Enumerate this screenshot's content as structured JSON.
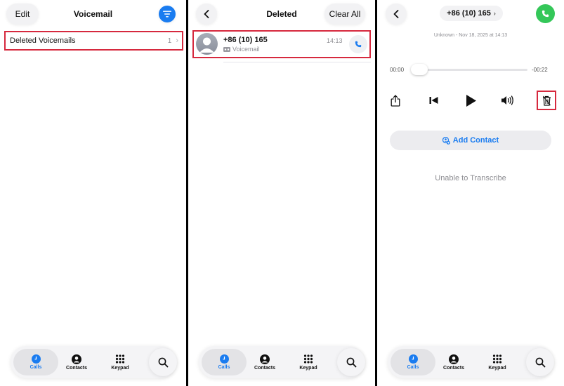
{
  "screen1": {
    "edit_label": "Edit",
    "title": "Voicemail",
    "row_label": "Deleted Voicemails",
    "row_count": "1"
  },
  "screen2": {
    "title": "Deleted",
    "clear_all_label": "Clear All",
    "entry": {
      "number": "+86 (10) 165",
      "subtitle": "Voicemail",
      "time": "14:13"
    }
  },
  "screen3": {
    "number": "+86 (10) 165",
    "meta": "Unknown - Nov 18, 2025 at 14:13",
    "elapsed": "00:00",
    "remaining": "-00:22",
    "progress_percent": 0,
    "add_contact_label": "Add Contact",
    "transcription": "Unable to Transcribe"
  },
  "tabbar": {
    "calls": "Calls",
    "contacts": "Contacts",
    "keypad": "Keypad"
  },
  "colors": {
    "accent": "#1a7cf0",
    "highlight": "#d6293e",
    "call_green": "#34c759"
  },
  "icons": [
    "filter-icon",
    "chevron-right-icon",
    "chevron-left-icon",
    "phone-icon",
    "share-icon",
    "skip-back-icon",
    "play-icon",
    "speaker-icon",
    "trash-icon",
    "add-contact-icon",
    "clock-icon",
    "person-icon",
    "keypad-icon",
    "search-icon"
  ]
}
